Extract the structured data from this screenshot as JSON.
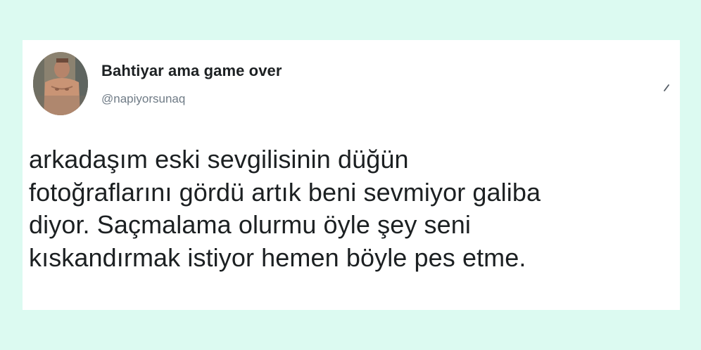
{
  "tweet": {
    "display_name": "Bahtiyar ama game over",
    "handle": "@napiyorsunaq",
    "text": "arkadaşım eski sevgilisinin düğün\nfotoğraflarını gördü artık beni sevmiyor galiba\ndiyor. Saçmalama olurmu öyle şey seni\nkıskandırmak istiyor hemen böyle pes etme.",
    "avatar": "profile-photo",
    "menu_icon": "chevron-down-icon"
  },
  "colors": {
    "page_background": "#dcfaf1",
    "card_background": "#ffffff",
    "text_primary": "#1c2022",
    "text_secondary": "#6f7b86"
  }
}
